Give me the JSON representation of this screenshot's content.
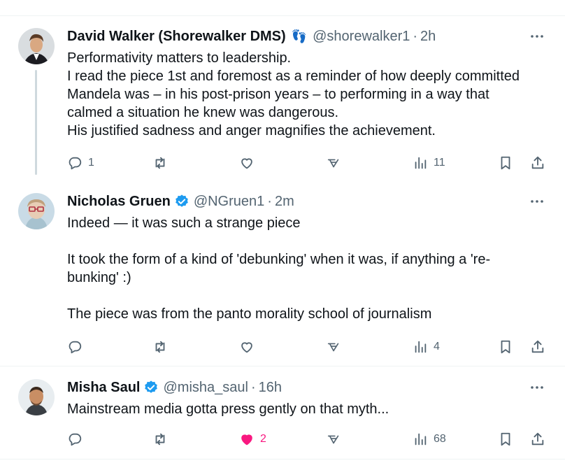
{
  "colors": {
    "text": "#0f1419",
    "muted": "#536471",
    "verified": "#1d9bf0",
    "like_active": "#f91880",
    "divider": "#eff3f4",
    "thread_line": "#cfd9de"
  },
  "icons": {
    "reply": "reply-icon",
    "repost": "repost-icon",
    "like": "heart-icon",
    "grok": "grok-icon",
    "views": "views-icon",
    "bookmark": "bookmark-icon",
    "share": "share-icon",
    "more": "more-icon",
    "verified": "verified-badge-icon"
  },
  "tweets": [
    {
      "name": "David Walker (Shorewalker DMS)",
      "emoji": "👣",
      "handle": "@shorewalker1",
      "dot": "·",
      "time": "2h",
      "lines": [
        "Performativity matters to leadership.",
        "I read the piece 1st and foremost as a reminder of how deeply committed",
        "Mandela was – in his post-prison years – to performing in a way that",
        "calmed a situation he knew was dangerous.",
        "His justified sadness and anger magnifies the achievement."
      ],
      "replies": "1",
      "reposts": "",
      "likes": "",
      "views": "11",
      "liked": false
    },
    {
      "name": "Nicholas Gruen",
      "verified": true,
      "handle": "@NGruen1",
      "dot": "·",
      "time": "2m",
      "lines": [
        "Indeed — it was such a strange piece",
        "",
        "It took the form of a kind of 'debunking' when it was, if anything a 're-",
        "bunking' :)",
        "",
        "The piece was from the panto morality school of journalism"
      ],
      "replies": "",
      "reposts": "",
      "likes": "",
      "views": "4",
      "liked": false
    },
    {
      "name": "Misha Saul",
      "verified": true,
      "handle": "@misha_saul",
      "dot": "·",
      "time": "16h",
      "lines": [
        "Mainstream media gotta press gently on that myth..."
      ],
      "replies": "",
      "reposts": "",
      "likes": "2",
      "views": "68",
      "liked": true
    }
  ]
}
